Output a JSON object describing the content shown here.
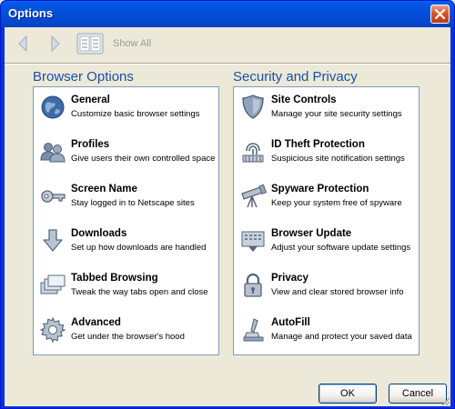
{
  "window": {
    "title": "Options",
    "close_icon": "close-icon"
  },
  "toolbar": {
    "back_icon": "back-arrow-icon",
    "forward_icon": "forward-arrow-icon",
    "show_all_icon": "show-all-grid-icon",
    "show_all_label": "Show All"
  },
  "sections": [
    {
      "heading": "Browser Options",
      "items": [
        {
          "title": "General",
          "desc": "Customize basic browser settings",
          "icon": "globe-icon"
        },
        {
          "title": "Profiles",
          "desc": "Give users their own controlled space",
          "icon": "users-icon"
        },
        {
          "title": "Screen Name",
          "desc": "Stay logged in to Netscape sites",
          "icon": "key-icon"
        },
        {
          "title": "Downloads",
          "desc": "Set up how downloads are handled",
          "icon": "download-arrow-icon"
        },
        {
          "title": "Tabbed Browsing",
          "desc": "Tweak the way tabs open and close",
          "icon": "tabs-icon"
        },
        {
          "title": "Advanced",
          "desc": "Get under the browser's hood",
          "icon": "gear-icon"
        }
      ]
    },
    {
      "heading": "Security and Privacy",
      "items": [
        {
          "title": "Site Controls",
          "desc": "Manage your site security settings",
          "icon": "shield-icon"
        },
        {
          "title": "ID Theft Protection",
          "desc": "Suspicious site notification settings",
          "icon": "fingerprint-icon"
        },
        {
          "title": "Spyware Protection",
          "desc": "Keep your system free of spyware",
          "icon": "telescope-icon"
        },
        {
          "title": "Browser Update",
          "desc": "Adjust your software update settings",
          "icon": "update-box-icon"
        },
        {
          "title": "Privacy",
          "desc": "View and clear stored browser info",
          "icon": "lock-icon"
        },
        {
          "title": "AutoFill",
          "desc": "Manage and protect your saved data",
          "icon": "autofill-stamp-icon"
        }
      ]
    }
  ],
  "buttons": {
    "ok": "OK",
    "cancel": "Cancel"
  },
  "colors": {
    "title_bar": "#0350DB",
    "heading": "#1A4FA8",
    "panel_border": "#7F9DB9",
    "dialog_bg": "#ECE9D8"
  }
}
